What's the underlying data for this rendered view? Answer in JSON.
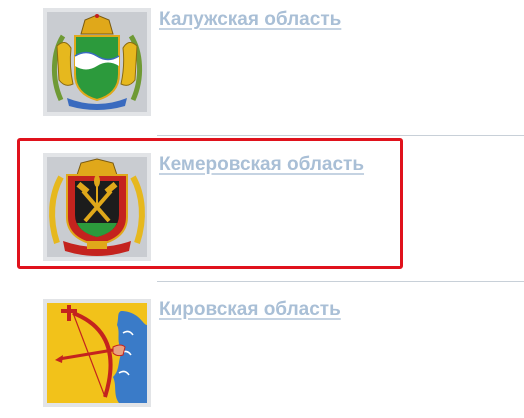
{
  "regions": [
    {
      "name": "Калужская область",
      "emblem": "kaluga-coat-of-arms-icon"
    },
    {
      "name": "Кемеровская область",
      "emblem": "kemerovo-coat-of-arms-icon",
      "selected": true
    },
    {
      "name": "Кировская область",
      "emblem": "kirov-coat-of-arms-icon"
    }
  ],
  "colors": {
    "link": "#a9bfd6",
    "highlight": "#e0121c",
    "separator": "#c8d0d8",
    "emblem_frame": "#e2e4e7"
  }
}
